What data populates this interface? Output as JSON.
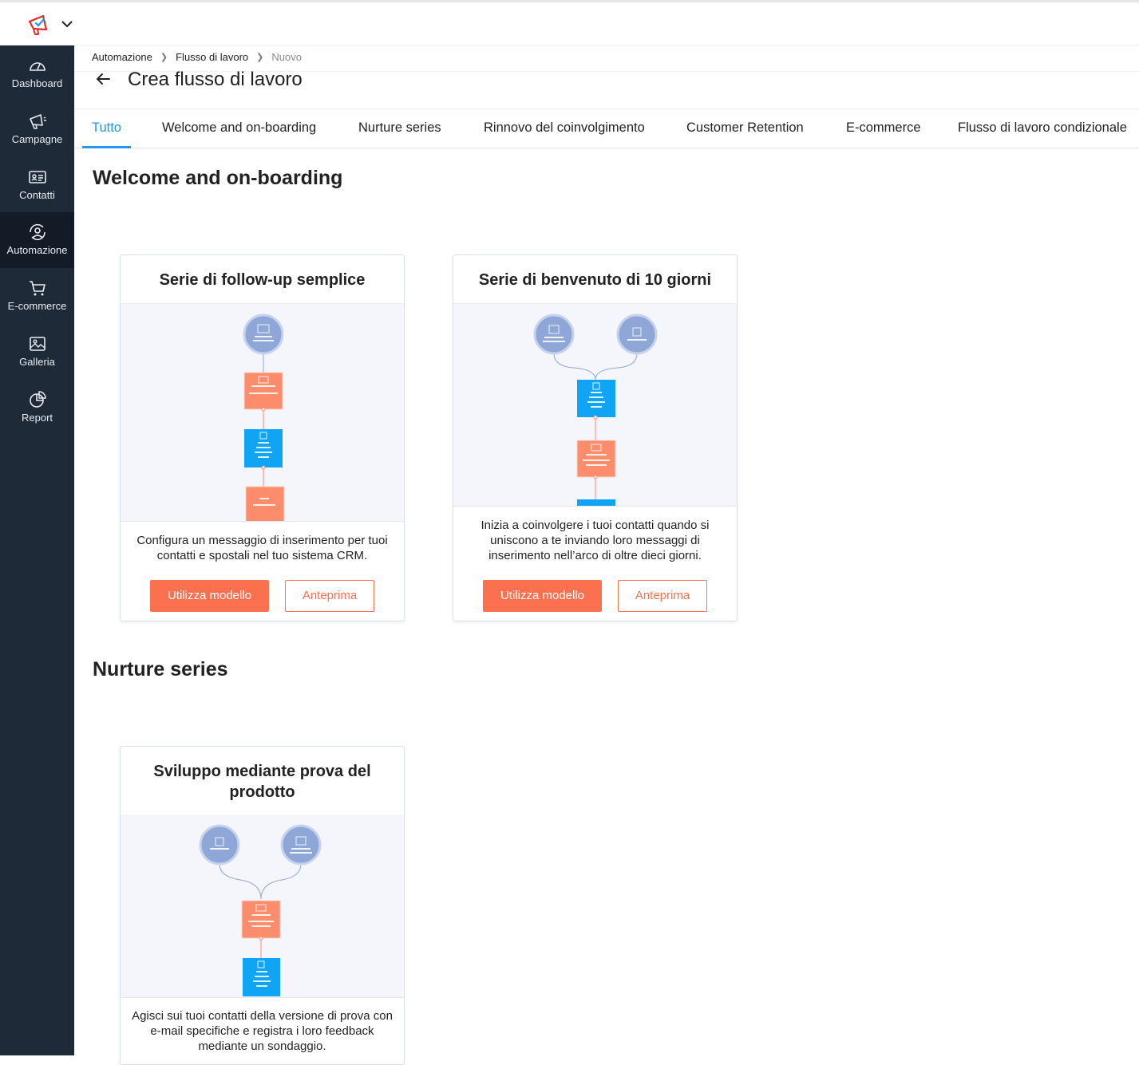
{
  "colors": {
    "accent": "#2196f3",
    "primary_button": "#fb7150",
    "sidebar_bg": "#1e2a38",
    "flow_trigger": "#8fa7d6",
    "flow_email": "#fb8c6c",
    "flow_wait": "#10a4f4"
  },
  "sidebar": {
    "items": [
      {
        "label": "Dashboard",
        "icon": "dashboard-icon"
      },
      {
        "label": "Campagne",
        "icon": "megaphone-icon"
      },
      {
        "label": "Contatti",
        "icon": "contact-card-icon"
      },
      {
        "label": "Automazione",
        "icon": "automation-icon"
      },
      {
        "label": "E-commerce",
        "icon": "cart-icon"
      },
      {
        "label": "Galleria",
        "icon": "gallery-icon"
      },
      {
        "label": "Report",
        "icon": "pie-chart-icon"
      }
    ]
  },
  "breadcrumb": {
    "items": [
      "Automazione",
      "Flusso di lavoro",
      "Nuovo"
    ]
  },
  "header": {
    "title": "Crea flusso di lavoro"
  },
  "tabs": [
    "Tutto",
    "Welcome and on-boarding",
    "Nurture series",
    "Rinnovo del coinvolgimento",
    "Customer Retention",
    "E-commerce",
    "Flusso di lavoro condizionale"
  ],
  "sections": [
    {
      "title": "Welcome and on-boarding",
      "cards": [
        {
          "title": "Serie di follow-up semplice",
          "description": "Configura un messaggio di inserimento per tuoi contatti e spostali nel tuo sistema CRM.",
          "use_label": "Utilizza modello",
          "preview_label": "Anteprima"
        },
        {
          "title": "Serie di benvenuto di 10 giorni",
          "description": "Inizia a coinvolgere i tuoi contatti quando si uniscono a te inviando loro messaggi di inserimento nell’arco di oltre dieci giorni.",
          "use_label": "Utilizza modello",
          "preview_label": "Anteprima"
        }
      ]
    },
    {
      "title": "Nurture series",
      "cards": [
        {
          "title": "Sviluppo mediante prova del prodotto",
          "description": "Agisci sui tuoi contatti della versione di prova con e-mail specifiche e registra i loro feedback mediante un sondaggio."
        }
      ]
    }
  ]
}
